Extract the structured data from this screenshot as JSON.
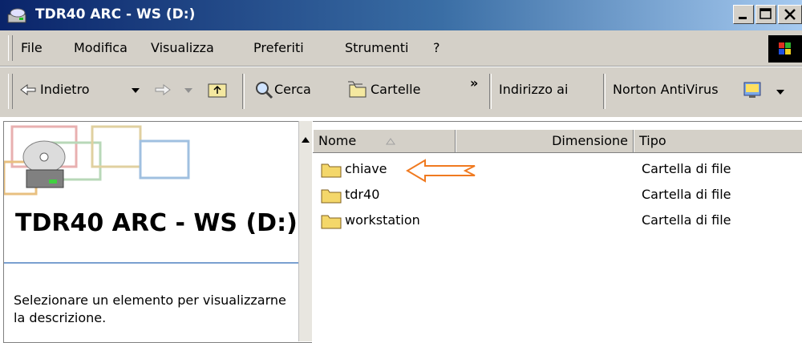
{
  "window": {
    "title": "TDR40 ARC - WS (D:)"
  },
  "menu": [
    "File",
    "Modifica",
    "Visualizza",
    "Preferiti",
    "Strumenti",
    "?"
  ],
  "toolbar": {
    "back_label": "Indietro",
    "search_label": "Cerca",
    "folders_label": "Cartelle",
    "more": "»",
    "address_label": "Indirizzo ai",
    "norton_label": "Norton AntiVirus"
  },
  "left_pane": {
    "title": "TDR40 ARC - WS (D:)",
    "description": "Selezionare un elemento per visualizzarne la descrizione."
  },
  "columns": {
    "name": "Nome",
    "size": "Dimensione",
    "type": "Tipo"
  },
  "files": [
    {
      "name": "chiave",
      "type": "Cartella di file"
    },
    {
      "name": "tdr40",
      "type": "Cartella di file"
    },
    {
      "name": "workstation",
      "type": "Cartella di file"
    }
  ],
  "colors": {
    "title_gradient_start": "#0a246a",
    "title_gradient_end": "#a6caf0",
    "chrome": "#d4d0c8",
    "annotation_arrow": "#f07a20",
    "folder": "#f4d76a"
  },
  "icons": {
    "title": "drive-icon",
    "folder": "folder-icon"
  }
}
